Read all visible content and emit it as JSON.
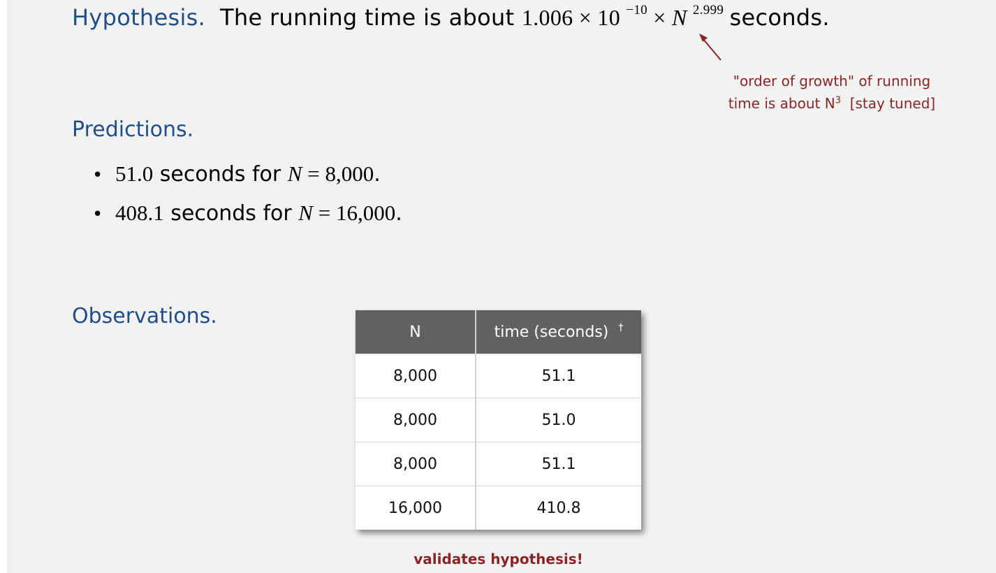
{
  "hypothesis": {
    "label": "Hypothesis.",
    "text_before": "The running time is about",
    "coefficient": "1.006",
    "times1": "×",
    "base": "10",
    "exponent1": "−10",
    "times2": "×",
    "variable": "N",
    "exponent2": "2.999",
    "text_after": "seconds."
  },
  "annotation": {
    "line1": "\"order of growth\" of running",
    "line2_prefix": "time is about N",
    "line2_exp": "3",
    "line2_suffix": "[stay tuned]",
    "color": "#8b2525"
  },
  "predictions": {
    "label": "Predictions.",
    "items": [
      {
        "bullet": "•",
        "value": "51.0",
        "mid": "seconds for",
        "var": "N",
        "eq": "=",
        "n": "8,000",
        "end": "."
      },
      {
        "bullet": "•",
        "value": "408.1",
        "mid": "seconds for",
        "var": "N",
        "eq": "=",
        "n": "16,000",
        "end": "."
      }
    ]
  },
  "observations": {
    "label": "Observations.",
    "table": {
      "headers": [
        "N",
        "time (seconds)"
      ],
      "header_mark": "†",
      "rows": [
        [
          "8,000",
          "51.1"
        ],
        [
          "8,000",
          "51.0"
        ],
        [
          "8,000",
          "51.1"
        ],
        [
          "16,000",
          "410.8"
        ]
      ]
    },
    "caption": "validates hypothesis!"
  },
  "colors": {
    "heading": "#1f4e89",
    "table_header": "#616161",
    "accent": "#8b2525",
    "background": "#f2f2f2"
  }
}
